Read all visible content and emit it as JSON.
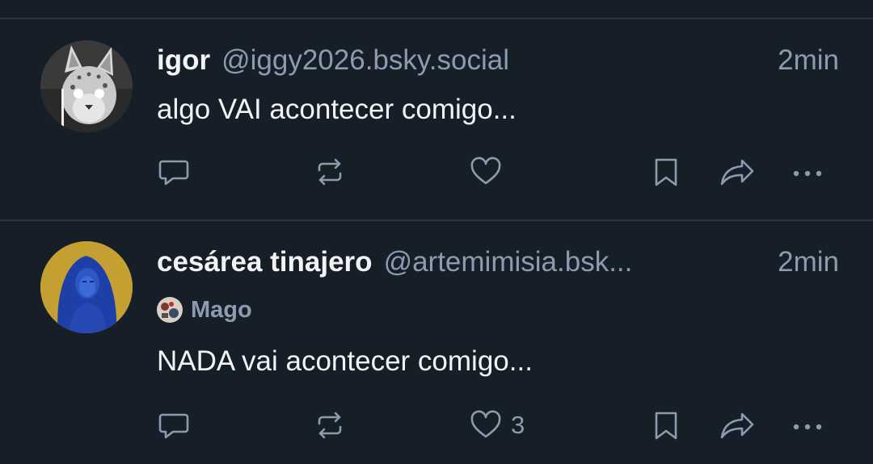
{
  "posts": [
    {
      "display_name": "igor",
      "handle": "@iggy2026.bsky.social",
      "time": "2min",
      "avatar_icon": "serval-cat-avatar",
      "text": "algo VAI acontecer comigo...",
      "like_count": ""
    },
    {
      "display_name": "cesárea tinajero",
      "handle": "@artemimisia.bsk...",
      "time": "2min",
      "avatar_icon": "blue-madonna-avatar",
      "label": {
        "icon": "mago-label-icon",
        "text": "Mago"
      },
      "text": "NADA vai acontecer comigo...",
      "like_count": "3"
    }
  ],
  "actions": [
    "reply-icon",
    "repost-icon",
    "like-icon",
    "bookmark-icon",
    "share-icon",
    "more-icon"
  ],
  "colors": {
    "background": "#161e27",
    "divider": "#2a3541",
    "primary_text": "#f1f3f5",
    "secondary_text": "#8c9cb0"
  }
}
